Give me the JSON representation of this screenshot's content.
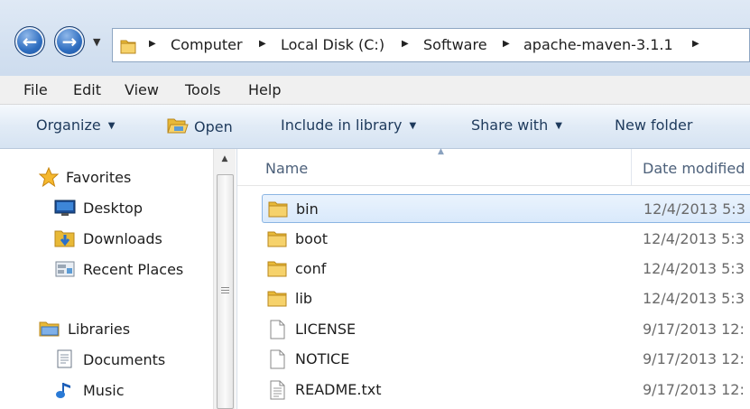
{
  "address_bar": {
    "breadcrumbs": [
      "Computer",
      "Local Disk (C:)",
      "Software",
      "apache-maven-3.1.1"
    ]
  },
  "menu": [
    "File",
    "Edit",
    "View",
    "Tools",
    "Help"
  ],
  "toolbar": {
    "organize": "Organize",
    "open": "Open",
    "include_in_library": "Include in library",
    "share_with": "Share with",
    "new_folder": "New folder"
  },
  "nav": {
    "favorites": "Favorites",
    "desktop": "Desktop",
    "downloads": "Downloads",
    "recent_places": "Recent Places",
    "libraries": "Libraries",
    "documents": "Documents",
    "music": "Music"
  },
  "columns": {
    "name": "Name",
    "date_modified": "Date modified"
  },
  "files": [
    {
      "name": "bin",
      "date": "12/4/2013 5:3",
      "type": "folder",
      "selected": true
    },
    {
      "name": "boot",
      "date": "12/4/2013 5:3",
      "type": "folder"
    },
    {
      "name": "conf",
      "date": "12/4/2013 5:3",
      "type": "folder"
    },
    {
      "name": "lib",
      "date": "12/4/2013 5:3",
      "type": "folder"
    },
    {
      "name": "LICENSE",
      "date": "9/17/2013 12:",
      "type": "file"
    },
    {
      "name": "NOTICE",
      "date": "9/17/2013 12:",
      "type": "file"
    },
    {
      "name": "README.txt",
      "date": "9/17/2013 12:",
      "type": "text"
    }
  ],
  "colors": {
    "accent": "#2f6ec0",
    "folder": "#e8b937",
    "selection": "#d9e9fb"
  }
}
